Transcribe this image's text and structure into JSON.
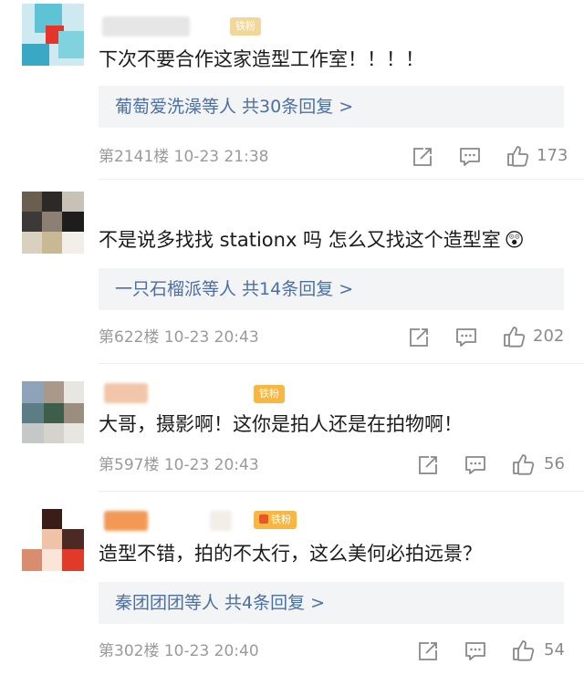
{
  "comments": [
    {
      "text": "下次不要合作这家造型工作室！！！！",
      "reply_summary": "葡萄爱洗澡等人  共30条回复 >",
      "floor": "第2141楼",
      "time": "10-23 21:38",
      "likes": "173",
      "badge": "铁粉"
    },
    {
      "text": "不是说多找找 stationx 吗 怎么又找这个造型室",
      "emoji": "😲",
      "reply_summary": "一只石榴派等人  共14条回复 >",
      "floor": "第622楼",
      "time": "10-23 20:43",
      "likes": "202"
    },
    {
      "text": "大哥，摄影啊！这你是拍人还是在拍物啊！",
      "floor": "第597楼",
      "time": "10-23 20:43",
      "likes": "56",
      "badge": "铁粉"
    },
    {
      "text": "造型不错，拍的不太行，这么美何必拍远景？",
      "reply_summary": "秦团团团等人  共4条回复 >",
      "floor": "第302楼",
      "time": "10-23 20:40",
      "likes": "54",
      "badge": "铁粉"
    }
  ],
  "colors": {
    "link": "#4a6fa5",
    "meta": "#9a9a9a",
    "badge": "#f7b742",
    "reply_bg": "#f3f4f6"
  },
  "icons": [
    "share-icon",
    "comment-icon",
    "like-icon"
  ]
}
